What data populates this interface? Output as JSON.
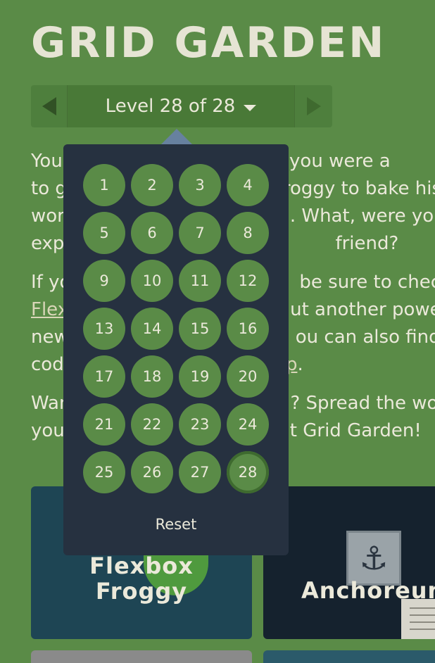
{
  "app": {
    "title": "GRID GARDEN"
  },
  "level_nav": {
    "prev_icon": "triangle-left-icon",
    "next_icon": "triangle-right-icon",
    "indicator": "Level 28 of 28",
    "caret_icon": "caret-down-icon"
  },
  "instructions": {
    "lines": [
      "You",
      "to g",
      "wor",
      "exp"
    ],
    "p1_right": [
      "S grid, you were a",
      "roggy to bake his",
      ". What, were you",
      "friend?"
    ],
    "p2_left": [
      "If yo",
      "Flex",
      "new",
      "cod"
    ],
    "p2_right": [
      "be sure to check o",
      "ut another power",
      "ou can also find r",
      "ip"
    ],
    "p2_tail": ".",
    "p3_left": [
      "Wan",
      "you"
    ],
    "p3_right": [
      "? Spread the wor",
      "t Grid Garden!"
    ]
  },
  "level_dropdown": {
    "levels": [
      "1",
      "2",
      "3",
      "4",
      "5",
      "6",
      "7",
      "8",
      "9",
      "10",
      "11",
      "12",
      "13",
      "14",
      "15",
      "16",
      "17",
      "18",
      "19",
      "20",
      "21",
      "22",
      "23",
      "24",
      "25",
      "26",
      "27",
      "28"
    ],
    "current": "28",
    "reset_label": "Reset"
  },
  "cards": {
    "froggy": {
      "label_line1": "Flexbox",
      "label_line2": "Froggy"
    },
    "anchor": {
      "label": "Anchoreum",
      "icon": "anchor-icon"
    }
  },
  "colors": {
    "background": "#5a8b47",
    "dropdown": "#263140",
    "level_button": "#5a8b47",
    "text": "#ebe9da"
  }
}
